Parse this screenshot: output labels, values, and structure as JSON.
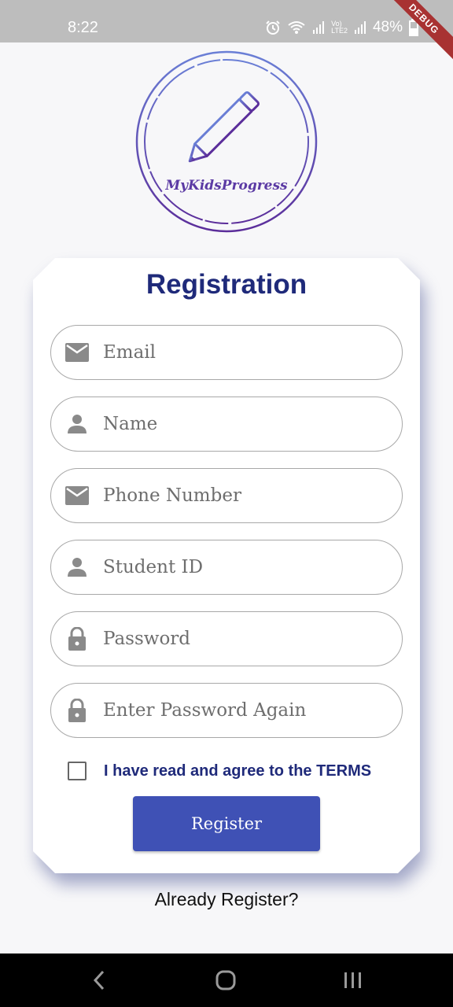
{
  "status_bar": {
    "time": "8:22",
    "battery_percent": "48%",
    "network_label_top": "Vo)",
    "network_label_bottom": "LTE2",
    "debug_banner": "DEBUG"
  },
  "logo": {
    "text": "MyKidsProgress",
    "colors": {
      "gradient_start": "#6a7fd6",
      "gradient_end": "#5b2d9a"
    }
  },
  "form": {
    "title": "Registration",
    "fields": [
      {
        "placeholder": "Email",
        "icon": "mail-icon"
      },
      {
        "placeholder": "Name",
        "icon": "person-icon"
      },
      {
        "placeholder": "Phone Number",
        "icon": "mail-icon"
      },
      {
        "placeholder": "Student ID",
        "icon": "person-icon"
      },
      {
        "placeholder": "Password",
        "icon": "lock-icon"
      },
      {
        "placeholder": "Enter Password Again",
        "icon": "lock-icon"
      }
    ],
    "terms_label": "I have read and agree to the TERMS",
    "terms_checked": false,
    "register_label": "Register"
  },
  "footer": {
    "already_register": "Already Register?"
  },
  "colors": {
    "title": "#1f2a7a",
    "button": "#3f51b5",
    "field_border": "#a8a8a8",
    "icon": "#8a8a8a"
  }
}
